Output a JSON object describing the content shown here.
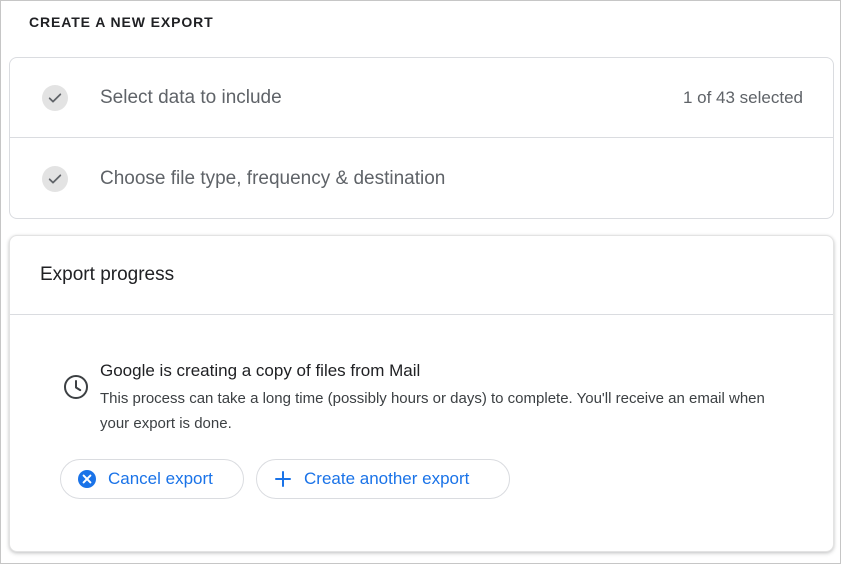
{
  "section_title": "CREATE A NEW EXPORT",
  "steps": [
    {
      "label": "Select data to include",
      "status": "1 of 43 selected",
      "icon": "checkmark-icon"
    },
    {
      "label": "Choose file type, frequency & destination",
      "icon": "checkmark-icon"
    }
  ],
  "progress": {
    "title": "Export progress",
    "status_title": "Google is creating a copy of files from Mail",
    "status_desc": "This process can take a long time (possibly hours or days) to complete. You'll receive an email when your export is done.",
    "icon": "clock-icon"
  },
  "actions": {
    "cancel_label": "Cancel export",
    "cancel_icon": "cancel-circle-icon",
    "create_label": "Create another export",
    "create_icon": "plus-icon"
  },
  "colors": {
    "accent": "#1a73e8",
    "text_secondary": "#5f6368",
    "border": "#dadce0",
    "check_bg": "#e3e3e3"
  }
}
